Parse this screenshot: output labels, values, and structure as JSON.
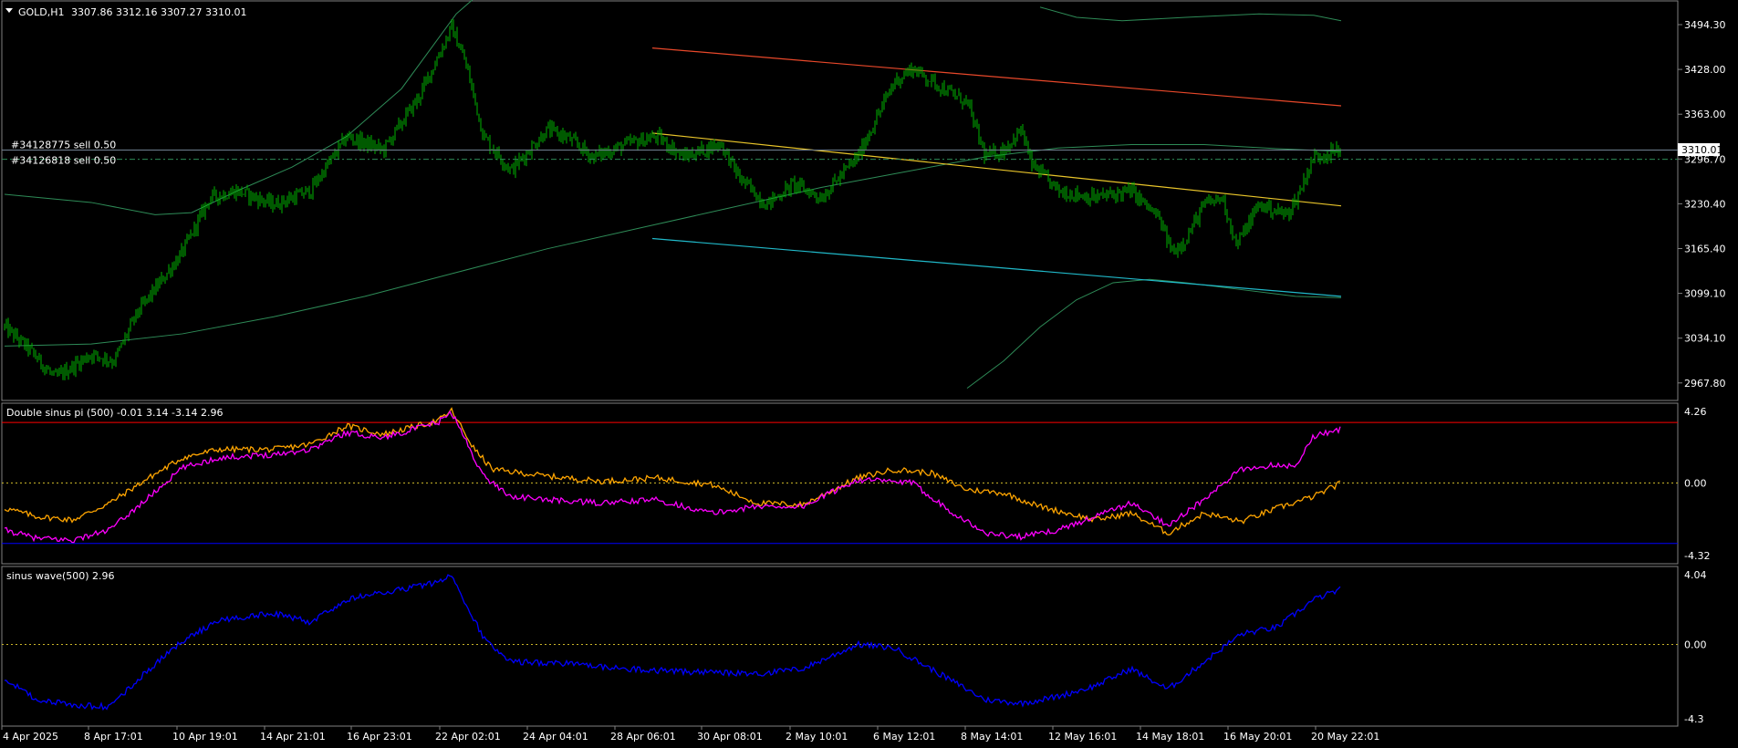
{
  "main_chart": {
    "symbol": "GOLD,H1",
    "ohlc": "3307.86 3312.16 3307.27 3310.01",
    "current_price": "3310.01",
    "orders": [
      {
        "label": "#34128775 sell 0.50",
        "price": 3310.0
      },
      {
        "label": "#34126818 sell 0.50",
        "price": 3296.5
      }
    ],
    "price_scale": [
      "3494.30",
      "3428.00",
      "3363.00",
      "3296.70",
      "3230.40",
      "3165.40",
      "3099.10",
      "3034.10",
      "2967.80"
    ],
    "colors": {
      "candles": "#00b400",
      "bands": "#2e8b57",
      "upper_channel": "#e8482a",
      "middle_channel": "#e8c42a",
      "lower_channel": "#20b8c8",
      "order_line": "#2e8b57"
    }
  },
  "indicator_1": {
    "title": "Double sinus pi (500) -0.01 3.14 -3.14 2.96",
    "scale": [
      "4.26",
      "0.00",
      "-4.32"
    ],
    "colors": {
      "line_a": "#ffa500",
      "line_b": "#ff00ff",
      "upper_level": "#ff0000",
      "lower_level": "#0000ff",
      "zero_level": "#c8b428"
    }
  },
  "indicator_2": {
    "title": "sinus wave(500) 2.96",
    "scale": [
      "4.04",
      "0.00",
      "-4.3"
    ],
    "colors": {
      "line": "#0000ff",
      "zero_level": "#c8b428"
    }
  },
  "time_axis": [
    "4 Apr 2025",
    "8 Apr 17:01",
    "10 Apr 19:01",
    "14 Apr 21:01",
    "16 Apr 23:01",
    "22 Apr 02:01",
    "24 Apr 04:01",
    "28 Apr 06:01",
    "30 Apr 08:01",
    "2 May 10:01",
    "6 May 12:01",
    "8 May 14:01",
    "12 May 16:01",
    "14 May 18:01",
    "16 May 20:01",
    "20 May 22:01"
  ]
}
